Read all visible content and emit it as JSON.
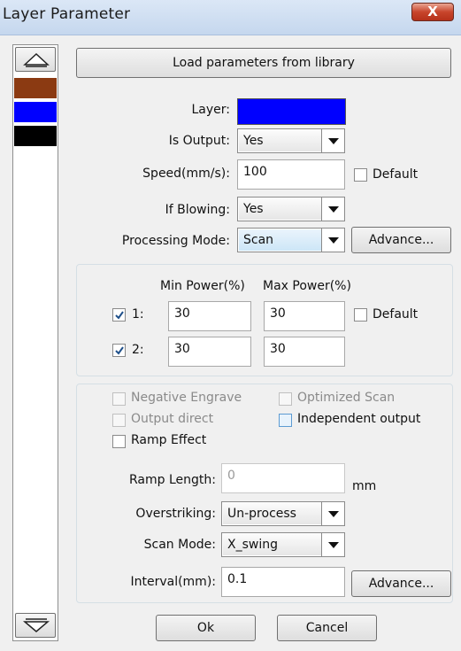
{
  "window": {
    "title": "Layer Parameter",
    "close_label": "X"
  },
  "layer_list": {
    "swatches": [
      {
        "color": "#8b3a12"
      },
      {
        "color": "#0000ff"
      },
      {
        "color": "#000000"
      }
    ]
  },
  "main": {
    "load_button": "Load parameters from library",
    "layer_label": "Layer:",
    "layer_color": "#0000ff",
    "is_output_label": "Is Output:",
    "is_output_value": "Yes",
    "speed_label": "Speed(mm/s):",
    "speed_value": "100",
    "speed_default_label": "Default",
    "if_blowing_label": "If Blowing:",
    "if_blowing_value": "Yes",
    "processing_mode_label": "Processing Mode:",
    "processing_mode_value": "Scan",
    "advance_label": "Advance..."
  },
  "power": {
    "min_header": "Min Power(%)",
    "max_header": "Max Power(%)",
    "default_label": "Default",
    "rows": [
      {
        "label": "1:",
        "checked": true,
        "min": "30",
        "max": "30"
      },
      {
        "label": "2:",
        "checked": true,
        "min": "30",
        "max": "30"
      }
    ]
  },
  "options": {
    "negative_engrave": "Negative Engrave",
    "optimized_scan": "Optimized Scan",
    "output_direct": "Output direct",
    "independent_output": "Independent output",
    "ramp_effect": "Ramp Effect",
    "ramp_length_label": "Ramp Length:",
    "ramp_length_value": "0",
    "ramp_unit": "mm",
    "overstriking_label": "Overstriking:",
    "overstriking_value": "Un-process",
    "scan_mode_label": "Scan Mode:",
    "scan_mode_value": "X_swing",
    "interval_label": "Interval(mm):",
    "interval_value": "0.1",
    "advance_label": "Advance..."
  },
  "footer": {
    "ok_label": "Ok",
    "cancel_label": "Cancel"
  }
}
